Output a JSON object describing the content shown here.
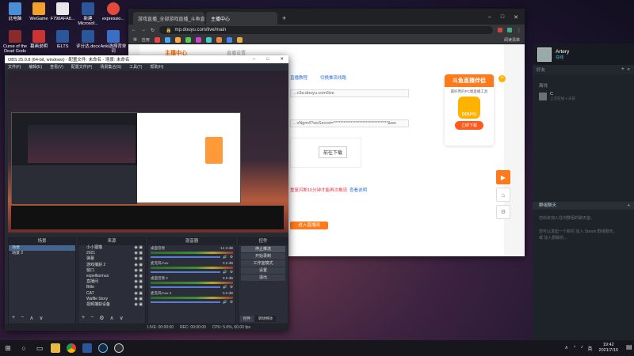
{
  "desktop": {
    "icons": [
      {
        "label": "此电脑",
        "color": "#4a8fd6"
      },
      {
        "label": "WeGame",
        "color": "#f2a12b"
      },
      {
        "label": "F798AFA8...",
        "color": "#e8e8e8"
      },
      {
        "label": "新建 Microsof...",
        "color": "#2b579a"
      },
      {
        "label": "expressio...",
        "color": "#e24a3a"
      },
      {
        "label": "Curse of the Dead Gods",
        "color": "#8a2b2b"
      },
      {
        "label": "幕画说明",
        "color": "#c33"
      },
      {
        "label": "IELTS",
        "color": "#2b579a"
      },
      {
        "label": "评分达.docx",
        "color": "#2b579a"
      },
      {
        "label": "Anki选择背单词",
        "color": "#3a6fc4"
      }
    ]
  },
  "chrome": {
    "tabs": [
      {
        "label": "游戏直播_全部游戏直播_斗鱼直...",
        "active": false
      },
      {
        "label": "主播中心",
        "active": true
      }
    ],
    "new_tab": "+",
    "window_controls": [
      "–",
      "□",
      "✕"
    ],
    "url": "mp.douyu.com/live/main",
    "bookmarks_label": "应用",
    "reading_list": "阅读清单",
    "page": {
      "title": "主播中心",
      "subtitle": "直播设置",
      "links": [
        "直播教程",
        "切换推流线路"
      ],
      "server_value": "...c3a.douyu.com/live",
      "key_value": "...vNgm4?wsSecret=********************************&ws",
      "start_button": "前往下载",
      "notice": "重复闪断10分钟才能再次推流",
      "notice_link": "查看说明",
      "live_button": "进入直播间",
      "promo": {
        "title": "斗鱼直播伴侣",
        "desc": "最好用的PC端直播工具",
        "logo": "DOUYU",
        "button": "立即下载"
      }
    }
  },
  "steam": {
    "username": "Artery",
    "status": "在线",
    "search_placeholder": "好友",
    "section_offline": "离线",
    "friend_name": "C",
    "friend_status": "上次在线 4 天前",
    "group_chat_header": "群组聊天",
    "group_chat_text": "您尚未加入任何群组的聊天室。",
    "join_hint": "您可以发起一个新的 加入 Steam 群组聊天。",
    "join_hint2": "或 加入群聊的..."
  },
  "obs": {
    "title": "OBS 25.0.8 (64-bit, windows) - 配置文件: 未命名 - 场景: 未命名",
    "menus": [
      "文件(F)",
      "编辑(E)",
      "查看(V)",
      "配置文件(P)",
      "场景集合(S)",
      "工具(T)",
      "帮助(H)"
    ],
    "docks": {
      "scenes": {
        "header": "场景",
        "items": [
          "场景",
          "场景 2"
        ]
      },
      "sources": {
        "header": "来源",
        "items": [
          "小小狸猫",
          "2021",
          "弹幕",
          "游戏捕获 2",
          "窗口",
          "expelliarmus",
          "直播间",
          "Bitte",
          "CAT",
          "Waffle Story",
          "视频捕获设备"
        ]
      },
      "mixer": {
        "header": "混音器",
        "channels": [
          {
            "name": "桌面音频",
            "db": "-14.3 dB"
          },
          {
            "name": "麦克风/Aux",
            "db": "0.0 dB"
          },
          {
            "name": "桌面音频 2",
            "db": "0.0 dB"
          },
          {
            "name": "麦克风/Aux 2",
            "db": "0.0 dB"
          }
        ]
      },
      "transitions": {
        "header": "转场特效"
      },
      "controls": {
        "header": "控件",
        "buttons": [
          "停止推流",
          "开始录制",
          "工作室模式",
          "设置",
          "退出"
        ],
        "tabs": [
          "控件",
          "转场特效"
        ]
      }
    },
    "status": {
      "live": "LIVE: 00:00:00",
      "rec": "REC: 00:00:00",
      "cpu": "CPU: 5.6%, 60.00 fps"
    }
  },
  "taskbar": {
    "time": "19:42",
    "date": "2021/7/15",
    "lang": "英"
  }
}
